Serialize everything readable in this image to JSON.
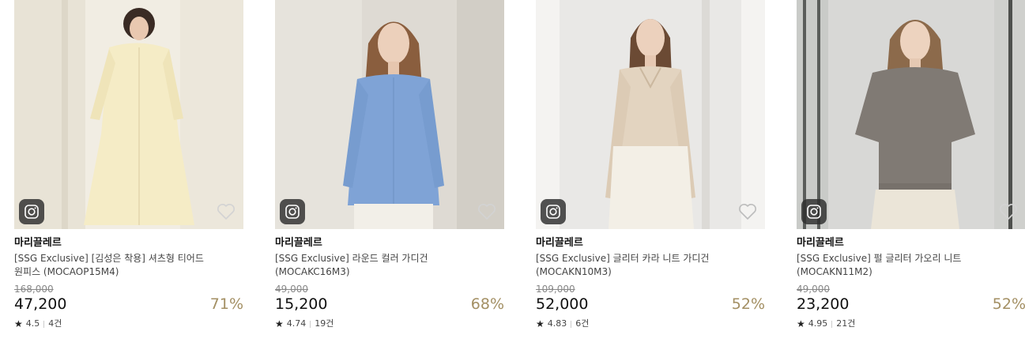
{
  "products": [
    {
      "brand": "마리끌레르",
      "title_line1": "[SSG Exclusive] [김성은 착용] 셔츠형 티어드",
      "title_line2": "원피스 (MOCAOP15M4)",
      "original_price": "168,000",
      "price": "47,200",
      "discount": "71%",
      "rating": "4.5",
      "reviews": "4건"
    },
    {
      "brand": "마리끌레르",
      "title_line1": "[SSG Exclusive] 라운드 컬러 가디건",
      "title_line2": "(MOCAKC16M3)",
      "original_price": "49,000",
      "price": "15,200",
      "discount": "68%",
      "rating": "4.74",
      "reviews": "19건"
    },
    {
      "brand": "마리끌레르",
      "title_line1": "[SSG Exclusive] 글리터 카라 니트 가디건",
      "title_line2": "(MOCAKN10M3)",
      "original_price": "109,000",
      "price": "52,000",
      "discount": "52%",
      "rating": "4.83",
      "reviews": "6건"
    },
    {
      "brand": "마리끌레르",
      "title_line1": "[SSG Exclusive] 펄 글리터 가오리 니트",
      "title_line2": "(MOCAKN11M2)",
      "original_price": "49,000",
      "price": "23,200",
      "discount": "52%",
      "rating": "4.95",
      "reviews": "21건"
    }
  ],
  "colors": {
    "discount": "#a38f63",
    "strike_price": "#888888",
    "insta_badge": "#2d2d2d"
  },
  "icons": {
    "photo_badge": "instagram-icon",
    "wishlist": "heart-icon",
    "rating": "star-icon"
  }
}
